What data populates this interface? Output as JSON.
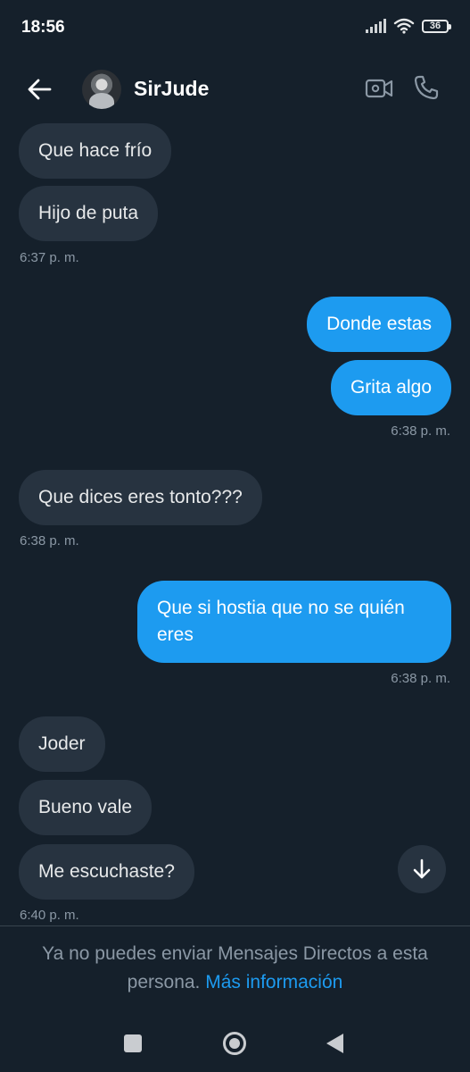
{
  "status_bar": {
    "time": "18:56",
    "battery": "36",
    "icons": [
      "signal-icon",
      "wifi-icon",
      "battery-icon"
    ]
  },
  "header": {
    "contact_name": "SirJude",
    "icons": [
      "back-arrow-icon",
      "avatar",
      "video-call-icon",
      "phone-icon"
    ]
  },
  "messages": [
    {
      "direction": "in",
      "text": "Que hace frío"
    },
    {
      "direction": "in",
      "text": "Hijo de puta",
      "timestamp": "6:37 p. m."
    },
    {
      "direction": "out",
      "text": "Donde estas"
    },
    {
      "direction": "out",
      "text": "Grita algo",
      "timestamp": "6:38 p. m."
    },
    {
      "direction": "in",
      "text": "Que dices eres tonto???",
      "timestamp": "6:38 p. m."
    },
    {
      "direction": "out",
      "text": "Que si hostia que no se quién eres",
      "timestamp": "6:38 p. m."
    },
    {
      "direction": "in",
      "text": "Joder"
    },
    {
      "direction": "in",
      "text": "Bueno vale"
    },
    {
      "direction": "in",
      "text": "Me escuchaste?",
      "timestamp": "6:40 p. m."
    }
  ],
  "notice": {
    "text": "Ya no puedes enviar Mensajes Directos a esta persona.",
    "link": "Más información"
  },
  "colors": {
    "background": "#15202b",
    "incoming_bubble": "#273340",
    "outgoing_bubble": "#1d9bf0",
    "secondary_text": "#8b98a5"
  },
  "nav_bar": {
    "icons": [
      "recents-icon",
      "home-icon",
      "back-triangle-icon"
    ]
  }
}
